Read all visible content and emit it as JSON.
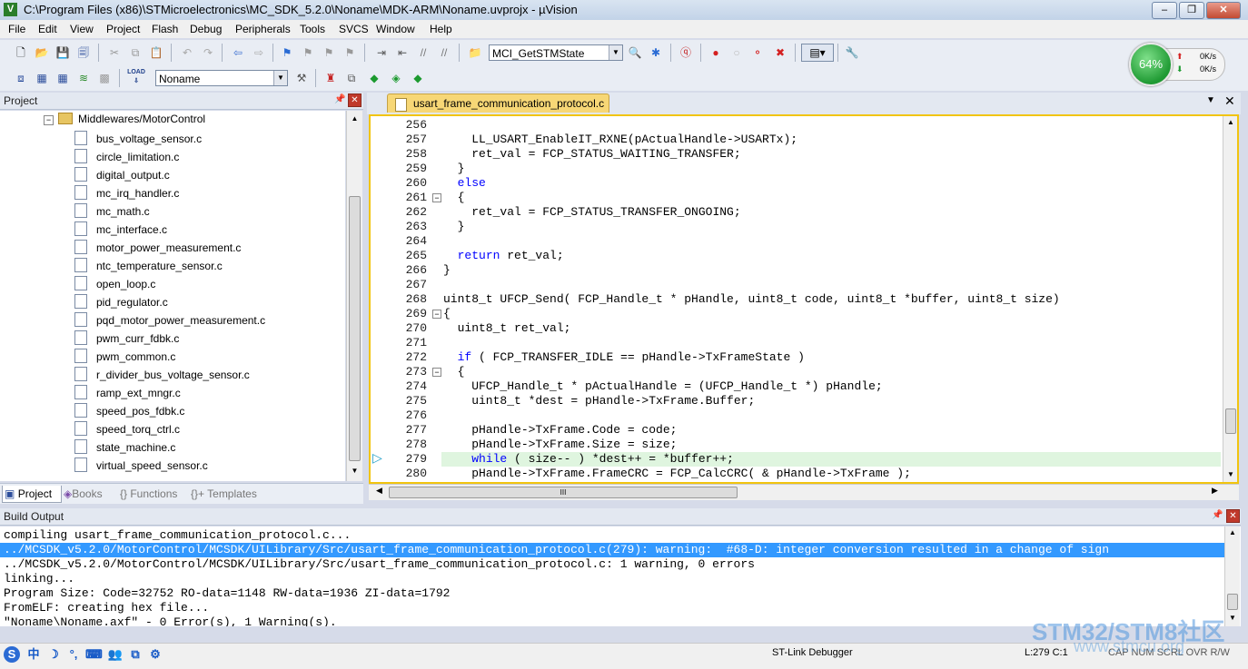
{
  "window": {
    "title": "C:\\Program Files (x86)\\STMicroelectronics\\MC_SDK_5.2.0\\Noname\\MDK-ARM\\Noname.uvprojx - µVision",
    "app_icon": "V",
    "controls": [
      "minimize-icon",
      "maximize-icon",
      "close-icon"
    ]
  },
  "menu": [
    "File",
    "Edit",
    "View",
    "Project",
    "Flash",
    "Debug",
    "Peripherals",
    "Tools",
    "SVCS",
    "Window",
    "Help"
  ],
  "toolbar": {
    "function_combo": "MCI_GetSTMState",
    "target_combo": "Noname",
    "load_label": "LOAD"
  },
  "cpu_widget": {
    "percent": "64%",
    "up_rate": "0K/s",
    "down_rate": "0K/s"
  },
  "project_panel": {
    "title": "Project",
    "folder": "Middlewares/MotorControl",
    "files": [
      "bus_voltage_sensor.c",
      "circle_limitation.c",
      "digital_output.c",
      "mc_irq_handler.c",
      "mc_math.c",
      "mc_interface.c",
      "motor_power_measurement.c",
      "ntc_temperature_sensor.c",
      "open_loop.c",
      "pid_regulator.c",
      "pqd_motor_power_measurement.c",
      "pwm_curr_fdbk.c",
      "pwm_common.c",
      "r_divider_bus_voltage_sensor.c",
      "ramp_ext_mngr.c",
      "speed_pos_fdbk.c",
      "speed_torq_ctrl.c",
      "state_machine.c",
      "virtual_speed_sensor.c"
    ],
    "tabs": [
      "Project",
      "Books",
      "{} Functions",
      "{}+ Templates"
    ]
  },
  "editor": {
    "tab_label": "usart_frame_communication_protocol.c",
    "lines": [
      {
        "n": "256",
        "text": ""
      },
      {
        "n": "257",
        "text": "    LL_USART_EnableIT_RXNE(pActualHandle->USARTx);"
      },
      {
        "n": "258",
        "text": "    ret_val = FCP_STATUS_WAITING_TRANSFER;"
      },
      {
        "n": "259",
        "text": "  }"
      },
      {
        "n": "260",
        "text": "  else",
        "kw": true
      },
      {
        "n": "261",
        "text": "  {",
        "fold": true
      },
      {
        "n": "262",
        "text": "    ret_val = FCP_STATUS_TRANSFER_ONGOING;"
      },
      {
        "n": "263",
        "text": "  }"
      },
      {
        "n": "264",
        "text": ""
      },
      {
        "n": "265",
        "text": "  return ret_val;",
        "kwpart": "return"
      },
      {
        "n": "266",
        "text": "}"
      },
      {
        "n": "267",
        "text": ""
      },
      {
        "n": "268",
        "text": "uint8_t UFCP_Send( FCP_Handle_t * pHandle, uint8_t code, uint8_t *buffer, uint8_t size)"
      },
      {
        "n": "269",
        "text": "{",
        "fold": true
      },
      {
        "n": "270",
        "text": "  uint8_t ret_val;"
      },
      {
        "n": "271",
        "text": ""
      },
      {
        "n": "272",
        "text": "  if ( FCP_TRANSFER_IDLE == pHandle->TxFrameState )",
        "kwpart": "if"
      },
      {
        "n": "273",
        "text": "  {",
        "fold": true
      },
      {
        "n": "274",
        "text": "    UFCP_Handle_t * pActualHandle = (UFCP_Handle_t *) pHandle;"
      },
      {
        "n": "275",
        "text": "    uint8_t *dest = pHandle->TxFrame.Buffer;"
      },
      {
        "n": "276",
        "text": ""
      },
      {
        "n": "277",
        "text": "    pHandle->TxFrame.Code = code;"
      },
      {
        "n": "278",
        "text": "    pHandle->TxFrame.Size = size;"
      },
      {
        "n": "279",
        "text": "    while ( size-- ) *dest++ = *buffer++;",
        "kwpart": "while",
        "current": true
      },
      {
        "n": "280",
        "text": "    pHandle->TxFrame.FrameCRC = FCP_CalcCRC( & pHandle->TxFrame );"
      }
    ],
    "hscroll_grip": "III"
  },
  "build_output": {
    "title": "Build Output",
    "lines": [
      "compiling usart_frame_communication_protocol.c...",
      "../MCSDK_v5.2.0/MotorControl/MCSDK/UILibrary/Src/usart_frame_communication_protocol.c(279): warning:  #68-D: integer conversion resulted in a change of sign",
      "../MCSDK_v5.2.0/MotorControl/MCSDK/UILibrary/Src/usart_frame_communication_protocol.c: 1 warning, 0 errors",
      "linking...",
      "Program Size: Code=32752 RO-data=1148 RW-data=1936 ZI-data=1792",
      "FromELF: creating hex file...",
      "\"Noname\\Noname.axf\" - 0 Error(s), 1 Warning(s)."
    ],
    "selected_index": 1
  },
  "statusbar": {
    "debugger": "ST-Link Debugger",
    "position": "L:279 C:1",
    "flags": "CAP  NUM  SCRL  OVR  R/W",
    "ime_chars": [
      "S",
      "中",
      "☽",
      "°,",
      "⌨",
      "👥",
      "⧉",
      "⚙"
    ]
  },
  "watermark": {
    "line1": "STM32/STM8社区",
    "line2": "www.stmcu.org"
  }
}
